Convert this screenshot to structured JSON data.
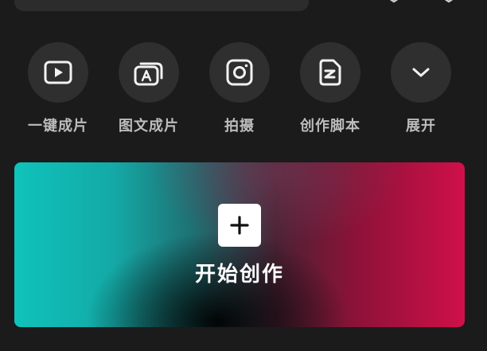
{
  "top_bar": {
    "icons": [
      "hexagon-icon",
      "hexagon-icon"
    ]
  },
  "tools": [
    {
      "label": "一键成片",
      "icon": "play-icon"
    },
    {
      "label": "图文成片",
      "icon": "text-to-video-icon"
    },
    {
      "label": "拍摄",
      "icon": "camera-icon"
    },
    {
      "label": "创作脚本",
      "icon": "script-icon"
    },
    {
      "label": "展开",
      "icon": "chevron-down-icon"
    }
  ],
  "create": {
    "label": "开始创作",
    "icon": "plus-icon"
  },
  "colors": {
    "background": "#1b1b1b",
    "tool_circle": "#2f2f2f",
    "tool_label": "#bdbdbd",
    "gradient_left": "#0fc3bb",
    "gradient_right": "#d0104a"
  }
}
